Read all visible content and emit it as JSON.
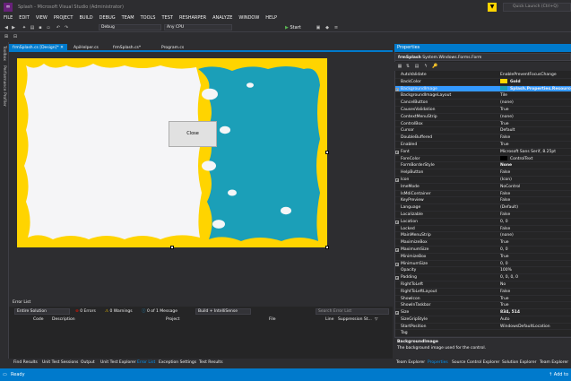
{
  "window": {
    "title": "Splash - Microsoft Visual Studio (Administrator)",
    "quick_launch": "Quick Launch (Ctrl+Q)"
  },
  "menu": [
    "FILE",
    "EDIT",
    "VIEW",
    "PROJECT",
    "BUILD",
    "DEBUG",
    "TEAM",
    "TOOLS",
    "TEST",
    "RESHARPER",
    "ANALYZE",
    "WINDOW",
    "HELP"
  ],
  "toolbar": {
    "config": "Debug",
    "platform": "Any CPU",
    "start": "Start"
  },
  "left_strip": [
    "Toolbox",
    "Performance Profiler"
  ],
  "doc_tabs": [
    "frmSplash.cs [Design]*",
    "ApiHelper.cs",
    "frmSplash.cs*",
    "Program.cs"
  ],
  "designer": {
    "close_button": "Close",
    "colors": {
      "back": "#ffd400",
      "left": "#f5f5f7",
      "right": "#1b9fb8"
    }
  },
  "error_list": {
    "title": "Error List",
    "scope": "Entire Solution",
    "errors": "0 Errors",
    "warnings": "0 Warnings",
    "messages": "0 of 1 Message",
    "build": "Build + IntelliSense",
    "search": "Search Error List",
    "columns": [
      "Code",
      "Description",
      "Project",
      "File",
      "Line",
      "Suppression St..."
    ]
  },
  "bottom_tabs": [
    "Find Results",
    "Unit Test Sessions",
    "Output",
    "Unit Test Explorer",
    "Error List",
    "Exception Settings",
    "Test Results"
  ],
  "properties": {
    "header": "Properties",
    "object": "frmSplash",
    "object_type": "System.Windows.Forms.Form",
    "rows": [
      {
        "n": "AutoValidate",
        "v": "EnablePreventFocusChange"
      },
      {
        "n": "BackColor",
        "v": "Gold",
        "swatch": "#ffd700",
        "bold": true
      },
      {
        "n": "BackgroundImage",
        "v": "Splash.Properties.Resources.S",
        "swatch": "#1b9fb8",
        "bold": true,
        "sel": true,
        "exp": "+"
      },
      {
        "n": "BackgroundImageLayout",
        "v": "Tile"
      },
      {
        "n": "CancelButton",
        "v": "(none)"
      },
      {
        "n": "CausesValidation",
        "v": "True"
      },
      {
        "n": "ContextMenuStrip",
        "v": "(none)"
      },
      {
        "n": "ControlBox",
        "v": "True"
      },
      {
        "n": "Cursor",
        "v": "Default"
      },
      {
        "n": "DoubleBuffered",
        "v": "False"
      },
      {
        "n": "Enabled",
        "v": "True"
      },
      {
        "n": "Font",
        "v": "Microsoft Sans Serif, 8.25pt",
        "exp": "+"
      },
      {
        "n": "ForeColor",
        "v": "ControlText",
        "swatch": "#000000"
      },
      {
        "n": "FormBorderStyle",
        "v": "None",
        "bold": true
      },
      {
        "n": "HelpButton",
        "v": "False"
      },
      {
        "n": "Icon",
        "v": "(Icon)",
        "exp": "+"
      },
      {
        "n": "ImeMode",
        "v": "NoControl"
      },
      {
        "n": "IsMdiContainer",
        "v": "False"
      },
      {
        "n": "KeyPreview",
        "v": "False"
      },
      {
        "n": "Language",
        "v": "(Default)"
      },
      {
        "n": "Localizable",
        "v": "False"
      },
      {
        "n": "Location",
        "v": "0, 0",
        "exp": "+"
      },
      {
        "n": "Locked",
        "v": "False"
      },
      {
        "n": "MainMenuStrip",
        "v": "(none)"
      },
      {
        "n": "MaximizeBox",
        "v": "True"
      },
      {
        "n": "MaximumSize",
        "v": "0, 0",
        "exp": "+"
      },
      {
        "n": "MinimizeBox",
        "v": "True"
      },
      {
        "n": "MinimumSize",
        "v": "0, 0",
        "exp": "+"
      },
      {
        "n": "Opacity",
        "v": "100%"
      },
      {
        "n": "Padding",
        "v": "0, 0, 0, 0",
        "exp": "+"
      },
      {
        "n": "RightToLeft",
        "v": "No"
      },
      {
        "n": "RightToLeftLayout",
        "v": "False"
      },
      {
        "n": "ShowIcon",
        "v": "True"
      },
      {
        "n": "ShowInTaskbar",
        "v": "True"
      },
      {
        "n": "Size",
        "v": "834, 514",
        "bold": true,
        "exp": "+"
      },
      {
        "n": "SizeGripStyle",
        "v": "Auto"
      },
      {
        "n": "StartPosition",
        "v": "WindowsDefaultLocation"
      },
      {
        "n": "Tag",
        "v": ""
      }
    ],
    "desc_title": "BackgroundImage",
    "desc_text": "The background image used for the control."
  },
  "right_tabs": [
    "Team Explorer",
    "Properties",
    "Source Control Explorer",
    "Solution Explorer",
    "Team Explorer"
  ],
  "status": {
    "text": "Ready",
    "right": "Add to"
  }
}
